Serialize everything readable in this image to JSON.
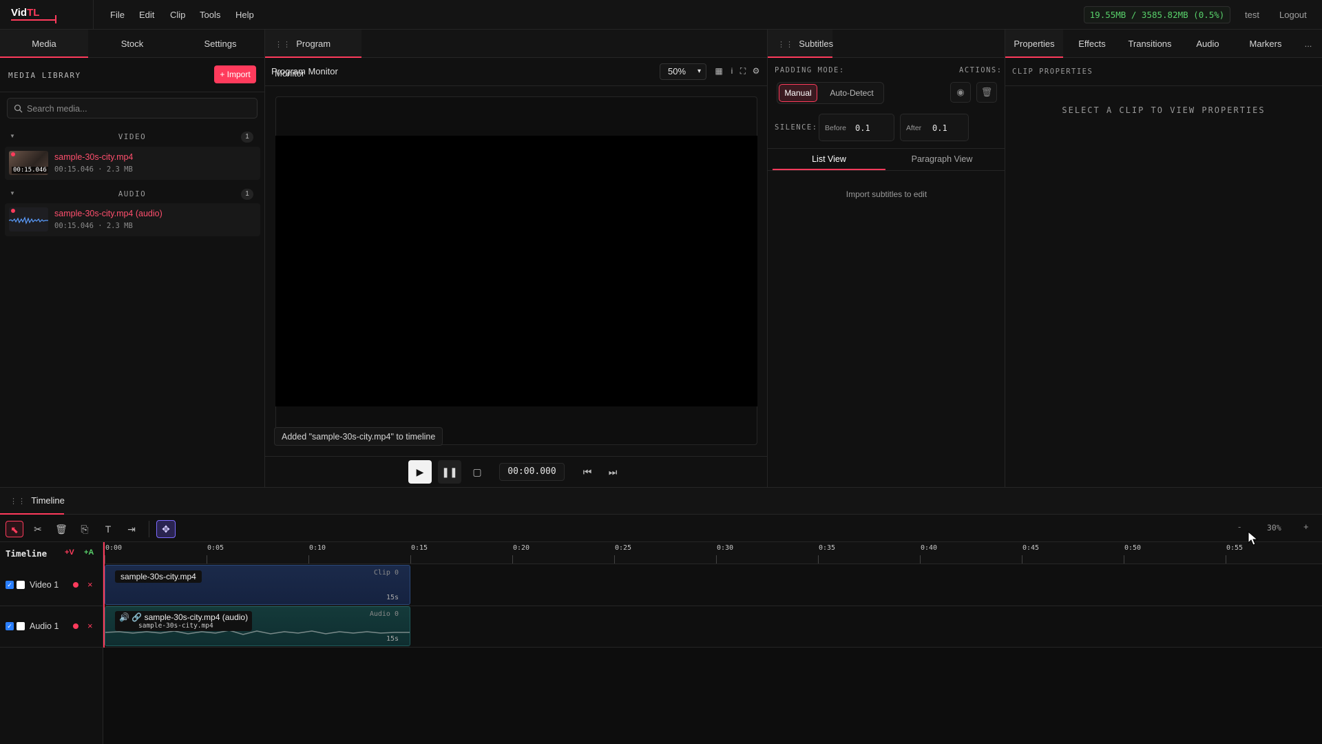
{
  "app": {
    "logo_main": "Vid",
    "logo_accent": "TL",
    "menu": [
      "File",
      "Edit",
      "Clip",
      "Tools",
      "Help"
    ],
    "memory": "19.55MB / 3585.82MB (0.5%)",
    "user": "test",
    "logout": "Logout",
    "accent_color": "#ff3b5c"
  },
  "media_panel": {
    "tabs": [
      "Media",
      "Stock",
      "Settings"
    ],
    "active_tab": "Media",
    "title": "MEDIA LIBRARY",
    "import_label": "+ Import",
    "search_placeholder": "Search media...",
    "sections": [
      {
        "label": "VIDEO",
        "count": "1",
        "items": [
          {
            "name": "sample-30s-city.mp4",
            "meta": "00:15.046 · 2.3 MB",
            "thumb_duration": "00:15.046"
          }
        ]
      },
      {
        "label": "AUDIO",
        "count": "1",
        "items": [
          {
            "name": "sample-30s-city.mp4 (audio)",
            "meta": "00:15.046 · 2.3 MB"
          }
        ]
      }
    ]
  },
  "monitor": {
    "tab": "Program Monitor",
    "title": "Program Monitor",
    "zoom": "50%",
    "toast": "Added \"sample-30s-city.mp4\" to timeline",
    "timecode": "00:00.000"
  },
  "subtitles": {
    "tab": "Subtitles",
    "padding_label": "PADDING MODE:",
    "actions_label": "ACTIONS:",
    "mode_manual": "Manual",
    "mode_auto": "Auto-Detect",
    "silence_label": "SILENCE:",
    "before_label": "Before",
    "before_value": "0.1",
    "after_label": "After",
    "after_value": "0.1",
    "list_view": "List View",
    "paragraph_view": "Paragraph View",
    "empty": "Import subtitles to edit"
  },
  "properties": {
    "tabs": [
      "Properties",
      "Effects",
      "Transitions",
      "Audio",
      "Markers"
    ],
    "more": "...",
    "title": "CLIP PROPERTIES",
    "empty": "SELECT A CLIP TO VIEW PROPERTIES"
  },
  "timeline": {
    "tab": "Timeline",
    "label": "Timeline",
    "add_video": "+V",
    "add_audio": "+A",
    "zoom_minus": "-",
    "zoom": "30%",
    "zoom_plus": "+",
    "ruler_labels": [
      "0:00",
      "0:05",
      "0:10",
      "0:15",
      "0:20",
      "0:25",
      "0:30",
      "0:35",
      "0:40",
      "0:45",
      "0:50",
      "0:55"
    ],
    "tracks": [
      {
        "name": "Video 1",
        "clip_label": "sample-30s-city.mp4",
        "clip_id": "Clip 0",
        "clip_length": "15s"
      },
      {
        "name": "Audio 1",
        "clip_label": "sample-30s-city.mp4 (audio)",
        "clip_sub": "sample-30s-city.mp4",
        "clip_id": "Audio 0",
        "clip_length": "15s"
      }
    ]
  }
}
